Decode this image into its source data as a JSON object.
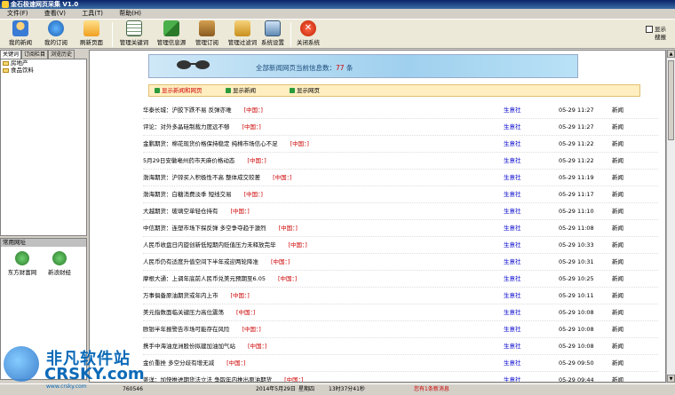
{
  "window": {
    "title": "金石极速网页采集 V1.0"
  },
  "menu": [
    "文件(F)",
    "查看(V)",
    "工具(T)",
    "帮助(H)"
  ],
  "toolbar": {
    "buttons": [
      {
        "label": "我的新闻"
      },
      {
        "label": "我的订阅"
      },
      {
        "label": "刷新页面"
      },
      {
        "label": "管理关键词"
      },
      {
        "label": "管理信息源"
      },
      {
        "label": "管理订阅"
      },
      {
        "label": "管理过滤词"
      },
      {
        "label": "系统设置"
      },
      {
        "label": "关闭系统"
      }
    ],
    "show_search": "显示搜报"
  },
  "left": {
    "tabs": [
      "关键词",
      "订阅栏目",
      "浏览历史"
    ],
    "tree": [
      "房地产",
      "食品饮料"
    ],
    "fav_header": "常用网址",
    "fav_items": [
      "东方财富网",
      "新浪财经"
    ]
  },
  "main": {
    "banner": {
      "prefix": "全部新闻网页当前信息数：",
      "count": "77",
      "suffix": " 条"
    },
    "filters": [
      "显示新闻和网页",
      "显示新闻",
      "显示网页"
    ],
    "news": [
      {
        "title": "华泰长城：沪胶下跌不易 反弹亦难",
        "tag": "[中国：]",
        "src": "生意社",
        "time": "05-29 11:27",
        "cat": "新闻"
      },
      {
        "title": "评论：对外多晶硅制裁力度远不够",
        "tag": "[中国：]",
        "src": "生意社",
        "time": "05-29 11:27",
        "cat": "新闻"
      },
      {
        "title": "金鹏期货：棉花现货价格保持稳定 纯棉市场信心不足",
        "tag": "[中国：]",
        "src": "生意社",
        "time": "05-29 11:22",
        "cat": "新闻"
      },
      {
        "title": "5月29日安徽亳州药市天麻价格动态",
        "tag": "[中国：]",
        "src": "生意社",
        "time": "05-29 11:22",
        "cat": "新闻"
      },
      {
        "title": "渤海期货：沪锌买入积极性不高 整体成交较差",
        "tag": "[中国：]",
        "src": "生意社",
        "time": "05-29 11:19",
        "cat": "新闻"
      },
      {
        "title": "渤海期货：白糖消费淡季 短线交易",
        "tag": "[中国：]",
        "src": "生意社",
        "time": "05-29 11:17",
        "cat": "新闻"
      },
      {
        "title": "大越期货：玻璃空单轻仓持有",
        "tag": "[中国：]",
        "src": "生意社",
        "time": "05-29 11:10",
        "cat": "新闻"
      },
      {
        "title": "中信期货：连塑市场下探反弹 多空争夺趋于激烈",
        "tag": "[中国：]",
        "src": "生意社",
        "time": "05-29 11:08",
        "cat": "新闻"
      },
      {
        "title": "人民币收盘日内旋创新低短期内贬值压力未释放完毕",
        "tag": "[中国：]",
        "src": "生意社",
        "time": "05-29 10:33",
        "cat": "新闻"
      },
      {
        "title": "人民币仍有适度升值空间下半年或迎两轮降准",
        "tag": "[中国：]",
        "src": "生意社",
        "time": "05-29 10:31",
        "cat": "新闻"
      },
      {
        "title": "摩根大通：上调年底前人民币兑美元预期至6.05",
        "tag": "[中国：]",
        "src": "生意社",
        "time": "05-29 10:25",
        "cat": "新闻"
      },
      {
        "title": "万事俱备原油期货或年内上市",
        "tag": "[中国：]",
        "src": "生意社",
        "time": "05-29 10:11",
        "cat": "新闻"
      },
      {
        "title": "美元指数面临关键压力高位震荡",
        "tag": "[中国：]",
        "src": "生意社",
        "time": "05-29 10:08",
        "cat": "新闻"
      },
      {
        "title": "欧银半年报警告市场可能存在风险",
        "tag": "[中国：]",
        "src": "生意社",
        "time": "05-29 10:08",
        "cat": "新闻"
      },
      {
        "title": "携手中海油龙洲股份拟建加油加气站",
        "tag": "[中国：]",
        "src": "生意社",
        "time": "05-29 10:08",
        "cat": "新闻"
      },
      {
        "title": "金价重挫 多空分歧有增无减",
        "tag": "[中国：]",
        "src": "生意社",
        "time": "05-29 09:50",
        "cat": "新闻"
      },
      {
        "title": "姜洋：加快推进期货法立法 争取年内推出原油期货",
        "tag": "[中国：]",
        "src": "生意社",
        "time": "05-29 09:44",
        "cat": "新闻"
      },
      {
        "title": "去库存接近有限 钢价跌势难改",
        "tag": "[中国：]",
        "src": "生意社",
        "time": "05-29 09:44",
        "cat": "新闻"
      }
    ]
  },
  "status": {
    "code": "760546",
    "date": "2014年5月29日",
    "weekday": "星期四",
    "clock": "13时37分41秒",
    "message": "您有1条新消息"
  },
  "watermark": {
    "cn": "非凡软件站",
    "en": "CRSKY.com",
    "url": "www.crsky.com"
  },
  "colors": {
    "title_bar": "#0a246a",
    "tag_red": "#cc0000",
    "source_blue": "#0000cc",
    "banner": "#9fd0ee",
    "filter_bg": "#ffeec0"
  }
}
